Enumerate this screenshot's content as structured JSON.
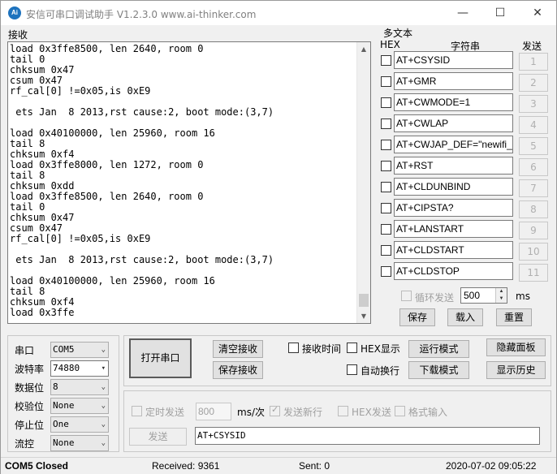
{
  "window": {
    "title": "安信可串口调试助手 V1.2.3.0    www.ai-thinker.com",
    "icon_text": "Ai",
    "minimize_icon": "minimize-icon",
    "maximize_icon": "maximize-icon",
    "close_icon": "close-icon"
  },
  "receive": {
    "label": "接收",
    "text": "load 0x3ffe8500, len 2640, room 0\ntail 0\nchksum 0x47\ncsum 0x47\nrf_cal[0] !=0x05,is 0xE9\n\n ets Jan  8 2013,rst cause:2, boot mode:(3,7)\n\nload 0x40100000, len 25960, room 16\ntail 8\nchksum 0xf4\nload 0x3ffe8000, len 1272, room 0\ntail 8\nchksum 0xdd\nload 0x3ffe8500, len 2640, room 0\ntail 0\nchksum 0x47\ncsum 0x47\nrf_cal[0] !=0x05,is 0xE9\n\n ets Jan  8 2013,rst cause:2, boot mode:(3,7)\n\nload 0x40100000, len 25960, room 16\ntail 8\nchksum 0xf4\nload 0x3ffe"
  },
  "multi_text": {
    "label": "多文本",
    "hex_header": "HEX",
    "string_header": "字符串",
    "send_header": "发送",
    "items": [
      {
        "text": "AT+CSYSID",
        "num": "1"
      },
      {
        "text": "AT+GMR",
        "num": "2"
      },
      {
        "text": "AT+CWMODE=1",
        "num": "3"
      },
      {
        "text": "AT+CWLAP",
        "num": "4"
      },
      {
        "text": "AT+CWJAP_DEF=\"newifi_",
        "num": "5"
      },
      {
        "text": "AT+RST",
        "num": "6"
      },
      {
        "text": "AT+CLDUNBIND",
        "num": "7"
      },
      {
        "text": "AT+CIPSTA?",
        "num": "8"
      },
      {
        "text": "AT+LANSTART",
        "num": "9"
      },
      {
        "text": "AT+CLDSTART",
        "num": "10"
      },
      {
        "text": "AT+CLDSTOP",
        "num": "11"
      }
    ],
    "loop_send_label": "循环发送",
    "loop_interval": "500",
    "loop_unit": "ms",
    "save_label": "保存",
    "load_label": "载入",
    "reset_label": "重置"
  },
  "serial": {
    "port_label": "串口",
    "port_value": "COM5",
    "baud_label": "波特率",
    "baud_value": "74880",
    "databits_label": "数据位",
    "databits_value": "8",
    "parity_label": "校验位",
    "parity_value": "None",
    "stopbits_label": "停止位",
    "stopbits_value": "One",
    "flow_label": "流控",
    "flow_value": "None"
  },
  "controls": {
    "open_port": "打开串口",
    "clear_receive": "清空接收",
    "save_receive": "保存接收",
    "receive_time": "接收时间",
    "hex_display": "HEX显示",
    "auto_wrap": "自动换行",
    "run_mode": "运行模式",
    "download_mode": "下载模式",
    "hide_panel": "隐藏面板",
    "show_history": "显示历史"
  },
  "send": {
    "timed_send": "定时发送",
    "interval_value": "800",
    "interval_unit": "ms/次",
    "send_newline": "发送新行",
    "hex_send": "HEX发送",
    "format_input": "格式输入",
    "send_button": "发送",
    "send_text": "AT+CSYSID"
  },
  "status": {
    "port_status": "COM5 Closed",
    "received": "Received: 9361",
    "sent": "Sent: 0",
    "datetime": "2020-07-02 09:05:22"
  }
}
